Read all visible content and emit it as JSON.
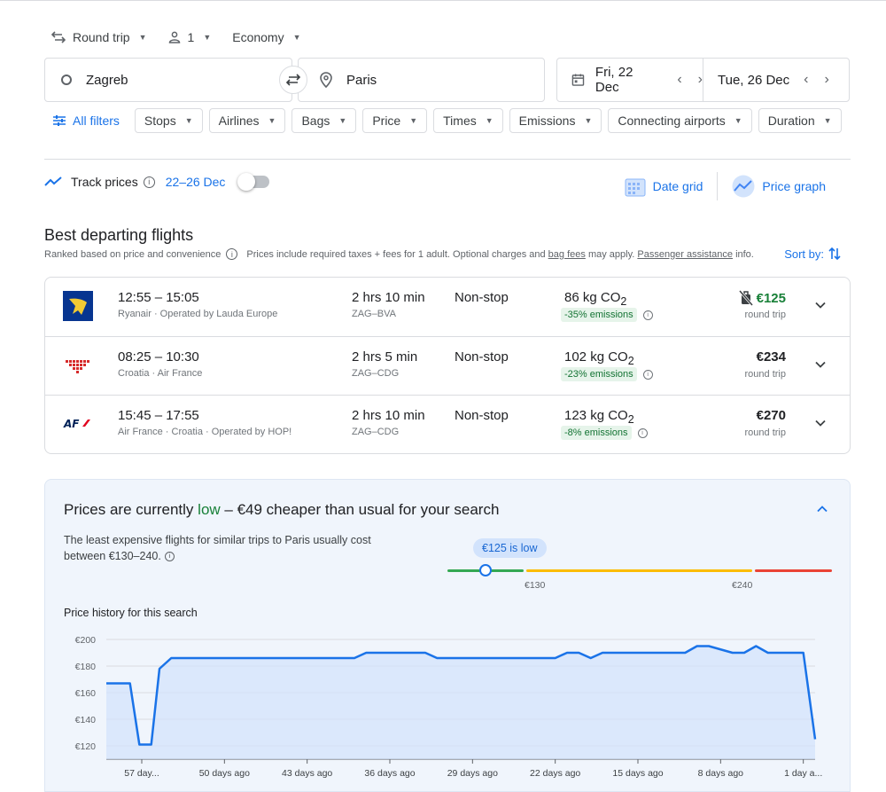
{
  "search": {
    "trip_type": "Round trip",
    "passengers": "1",
    "cabin": "Economy",
    "origin": "Zagreb",
    "destination": "Paris",
    "depart_date": "Fri, 22 Dec",
    "return_date": "Tue, 26 Dec"
  },
  "filters": {
    "all_label": "All filters",
    "chips": [
      "Stops",
      "Airlines",
      "Bags",
      "Price",
      "Times",
      "Emissions",
      "Connecting airports",
      "Duration"
    ]
  },
  "track": {
    "label": "Track prices",
    "range": "22–26 Dec"
  },
  "views": {
    "date_grid": "Date grid",
    "price_graph": "Price graph"
  },
  "results": {
    "heading": "Best departing flights",
    "ranked": "Ranked based on price and convenience",
    "note_prefix": "Prices include required taxes + fees for 1 adult. Optional charges and",
    "bag_fees": "bag fees",
    "note_mid": "may apply.",
    "assistance": "Passenger assistance",
    "note_suffix": "info.",
    "sort_label": "Sort by:",
    "flights": [
      {
        "times": "12:55 – 15:05",
        "airline": "Ryanair · Operated by Lauda Europe",
        "duration": "2 hrs 10 min",
        "route": "ZAG–BVA",
        "stops": "Non-stop",
        "co2": "86 kg CO",
        "emissions": "-35% emissions",
        "price": "€125",
        "price_type": "round trip"
      },
      {
        "times": "08:25 – 10:30",
        "airline": "Croatia · Air France",
        "duration": "2 hrs 5 min",
        "route": "ZAG–CDG",
        "stops": "Non-stop",
        "co2": "102 kg CO",
        "emissions": "-23% emissions",
        "price": "€234",
        "price_type": "round trip"
      },
      {
        "times": "15:45 – 17:55",
        "airline": "Air France · Croatia · Operated by HOP!",
        "duration": "2 hrs 10 min",
        "route": "ZAG–CDG",
        "stops": "Non-stop",
        "co2": "123 kg CO",
        "emissions": "-8% emissions",
        "price": "€270",
        "price_type": "round trip"
      }
    ]
  },
  "insights": {
    "title_prefix": "Prices are currently",
    "title_low": "low",
    "title_suffix": "– €49 cheaper than usual for your search",
    "desc": "The least expensive flights for similar trips to Paris usually cost between €130–240.",
    "badge": "€125 is low",
    "range_low": "€130",
    "range_high": "€240",
    "history_title": "Price history for this search"
  },
  "colors": {
    "accent": "#1a73e8",
    "green": "#188038",
    "gauge_green": "#34a853",
    "gauge_yellow": "#fbbc04",
    "gauge_red": "#ea4335"
  },
  "chart_data": {
    "type": "line",
    "ylim": [
      110,
      200
    ],
    "yticks": [
      "€200",
      "€180",
      "€160",
      "€140",
      "€120"
    ],
    "ytick_values": [
      200,
      180,
      160,
      140,
      120
    ],
    "xticks": [
      "57 day...",
      "50 days ago",
      "43 days ago",
      "36 days ago",
      "29 days ago",
      "22 days ago",
      "15 days ago",
      "8 days ago",
      "1 day a..."
    ],
    "xtick_values": [
      -57,
      -50,
      -43,
      -36,
      -29,
      -22,
      -15,
      -8,
      -1
    ],
    "series": [
      {
        "x": [
          -60,
          -58,
          -57.2,
          -56.2,
          -55.5,
          -54.5,
          -53,
          -39,
          -38,
          -33,
          -32,
          -28,
          -26,
          -22,
          -21,
          -20,
          -19,
          -18,
          -16,
          -12,
          -11,
          -10,
          -9,
          -7,
          -6,
          -5,
          -4,
          -1,
          0
        ],
        "y": [
          167,
          167,
          121,
          121,
          178,
          186,
          186,
          186,
          190,
          190,
          186,
          186,
          186,
          186,
          190,
          190,
          186,
          190,
          190,
          190,
          190,
          195,
          195,
          190,
          190,
          195,
          190,
          190,
          125
        ]
      }
    ]
  }
}
